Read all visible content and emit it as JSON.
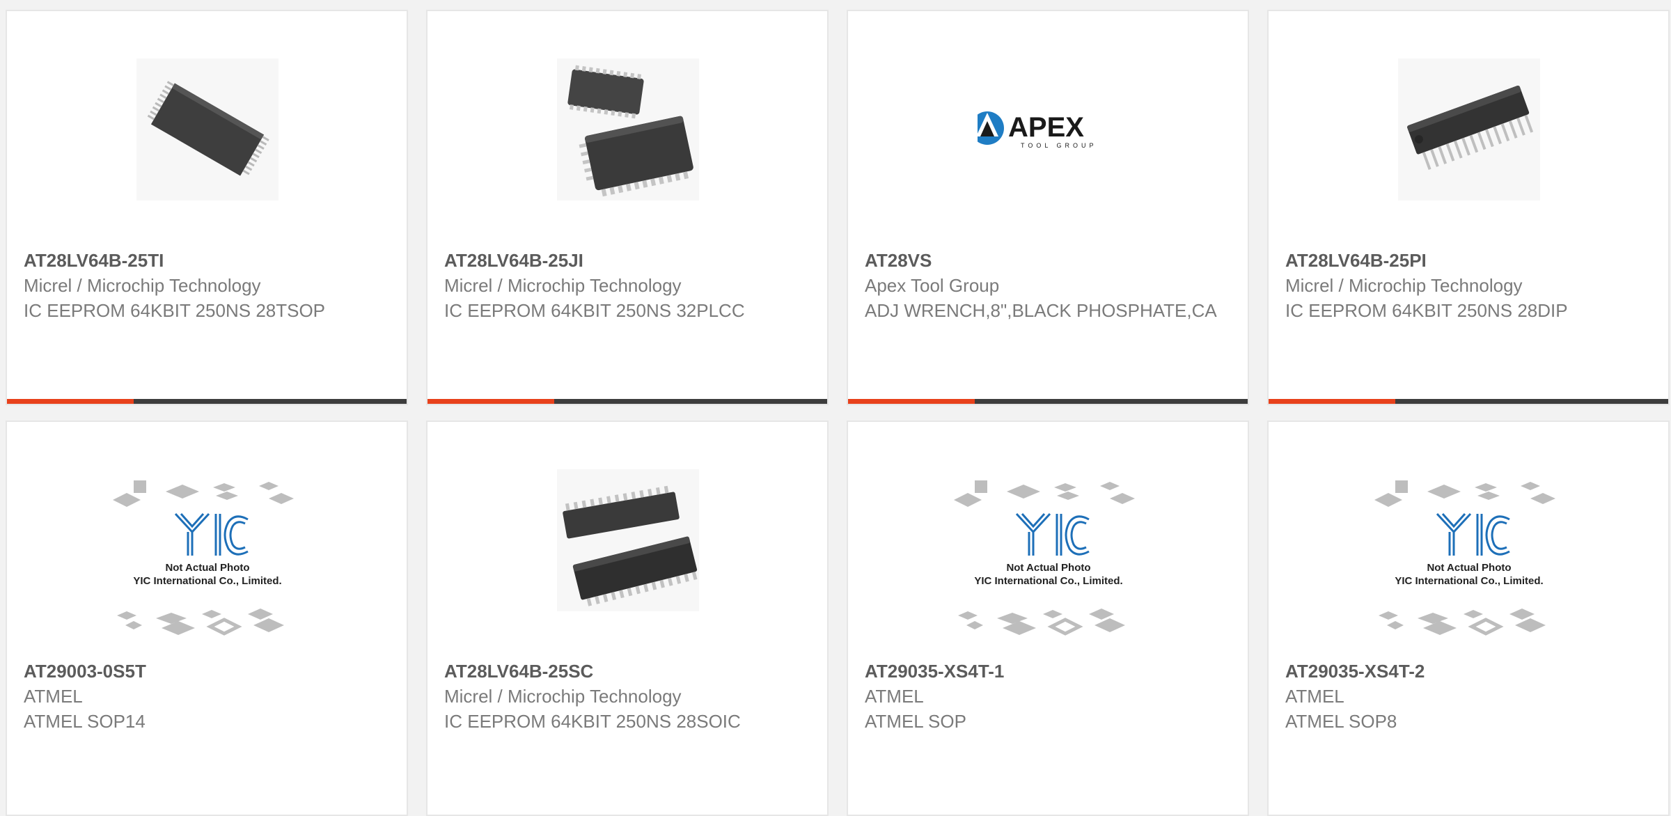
{
  "colors": {
    "accent": "#e8411b",
    "bar": "#3d3d3d",
    "part_number": "#5b5b5b",
    "body_text": "#7a7a7a",
    "card_border": "#e6e6e6",
    "yic_blue": "#1d6fb8"
  },
  "products": [
    {
      "part_number": "AT28LV64B-25TI",
      "manufacturer": "Micrel / Microchip Technology",
      "description": "IC EEPROM 64KBIT 250NS 28TSOP",
      "image": "tsop-chip-photo"
    },
    {
      "part_number": "AT28LV64B-25JI",
      "manufacturer": "Micrel / Microchip Technology",
      "description": "IC EEPROM 64KBIT 250NS 32PLCC",
      "image": "plcc-chip-photo"
    },
    {
      "part_number": "AT28VS",
      "manufacturer": "Apex Tool Group",
      "description": "ADJ WRENCH,8\",BLACK PHOSPHATE,CA",
      "image": "apex-tool-group-logo",
      "logo": {
        "name": "APEX",
        "tagline": "TOOL GROUP"
      }
    },
    {
      "part_number": "AT28LV64B-25PI",
      "manufacturer": "Micrel / Microchip Technology",
      "description": "IC EEPROM 64KBIT 250NS 28DIP",
      "image": "dip-chip-photo"
    },
    {
      "part_number": "AT29003-0S5T",
      "manufacturer": "ATMEL",
      "description": "ATMEL SOP14",
      "image": "placeholder-not-actual-photo",
      "placeholder": {
        "logo": "YIC",
        "line1": "Not Actual Photo",
        "line2": "YIC International Co., Limited."
      }
    },
    {
      "part_number": "AT28LV64B-25SC",
      "manufacturer": "Micrel / Microchip Technology",
      "description": "IC EEPROM 64KBIT 250NS 28SOIC",
      "image": "soic-chip-photo"
    },
    {
      "part_number": "AT29035-XS4T-1",
      "manufacturer": "ATMEL",
      "description": "ATMEL SOP",
      "image": "placeholder-not-actual-photo",
      "placeholder": {
        "logo": "YIC",
        "line1": "Not Actual Photo",
        "line2": "YIC International Co., Limited."
      }
    },
    {
      "part_number": "AT29035-XS4T-2",
      "manufacturer": "ATMEL",
      "description": "ATMEL SOP8",
      "image": "placeholder-not-actual-photo",
      "placeholder": {
        "logo": "YIC",
        "line1": "Not Actual Photo",
        "line2": "YIC International Co., Limited."
      }
    }
  ]
}
